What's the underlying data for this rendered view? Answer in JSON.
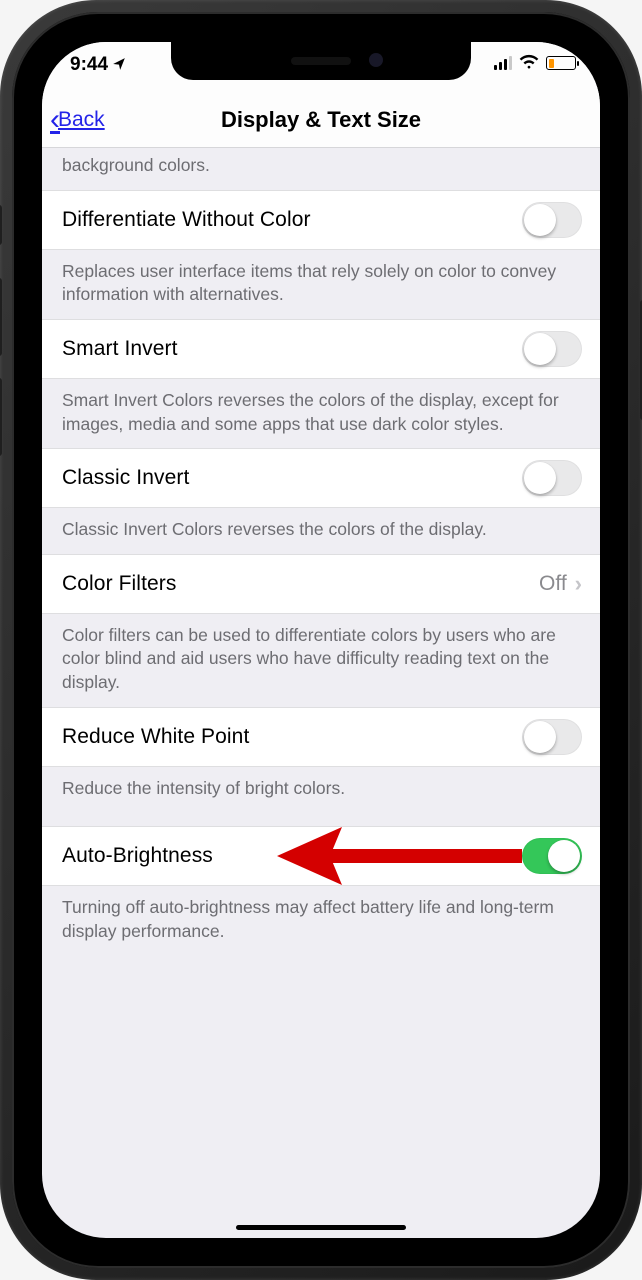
{
  "status": {
    "time": "9:44"
  },
  "nav": {
    "back": "Back",
    "title": "Display & Text Size"
  },
  "rows": {
    "partial_desc_top": "background colors.",
    "diff_label": "Differentiate Without Color",
    "diff_desc": "Replaces user interface items that rely solely on color to convey information with alternatives.",
    "smart_label": "Smart Invert",
    "smart_desc": "Smart Invert Colors reverses the colors of the display, except for images, media and some apps that use dark color styles.",
    "classic_label": "Classic Invert",
    "classic_desc": "Classic Invert Colors reverses the colors of the display.",
    "filters_label": "Color Filters",
    "filters_value": "Off",
    "filters_desc": "Color filters can be used to differentiate colors by users who are color blind and aid users who have difficulty reading text on the display.",
    "reduce_label": "Reduce White Point",
    "reduce_desc": "Reduce the intensity of bright colors.",
    "auto_label": "Auto-Brightness",
    "auto_desc": "Turning off auto-brightness may affect battery life and long-term display performance."
  },
  "switches": {
    "diff": false,
    "smart": false,
    "classic": false,
    "reduce": false,
    "auto": true
  }
}
